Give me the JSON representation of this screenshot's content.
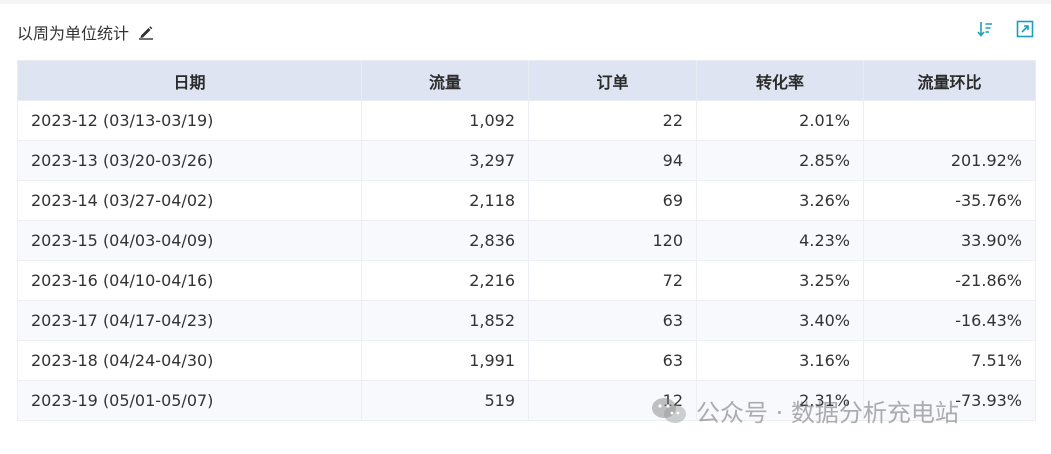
{
  "panel": {
    "title": "以周为单位统计"
  },
  "table": {
    "columns": [
      "日期",
      "流量",
      "订单",
      "转化率",
      "流量环比"
    ],
    "rows": [
      [
        "2023-12 (03/13-03/19)",
        "1,092",
        "22",
        "2.01%",
        ""
      ],
      [
        "2023-13 (03/20-03/26)",
        "3,297",
        "94",
        "2.85%",
        "201.92%"
      ],
      [
        "2023-14 (03/27-04/02)",
        "2,118",
        "69",
        "3.26%",
        "-35.76%"
      ],
      [
        "2023-15 (04/03-04/09)",
        "2,836",
        "120",
        "4.23%",
        "33.90%"
      ],
      [
        "2023-16 (04/10-04/16)",
        "2,216",
        "72",
        "3.25%",
        "-21.86%"
      ],
      [
        "2023-17 (04/17-04/23)",
        "1,852",
        "63",
        "3.40%",
        "-16.43%"
      ],
      [
        "2023-18 (04/24-04/30)",
        "1,991",
        "63",
        "3.16%",
        "7.51%"
      ],
      [
        "2023-19 (05/01-05/07)",
        "519",
        "12",
        "2.31%",
        "-73.93%"
      ]
    ]
  },
  "watermark": {
    "text": "公众号 · 数据分析充电站"
  },
  "icons": {
    "edit": "pencil-icon",
    "sort": "sort-descending-icon",
    "expand": "expand-icon"
  },
  "colors": {
    "header_bg": "#dfe4f3",
    "accent": "#1aa0b8",
    "row_alt": "#f8f9fc"
  }
}
